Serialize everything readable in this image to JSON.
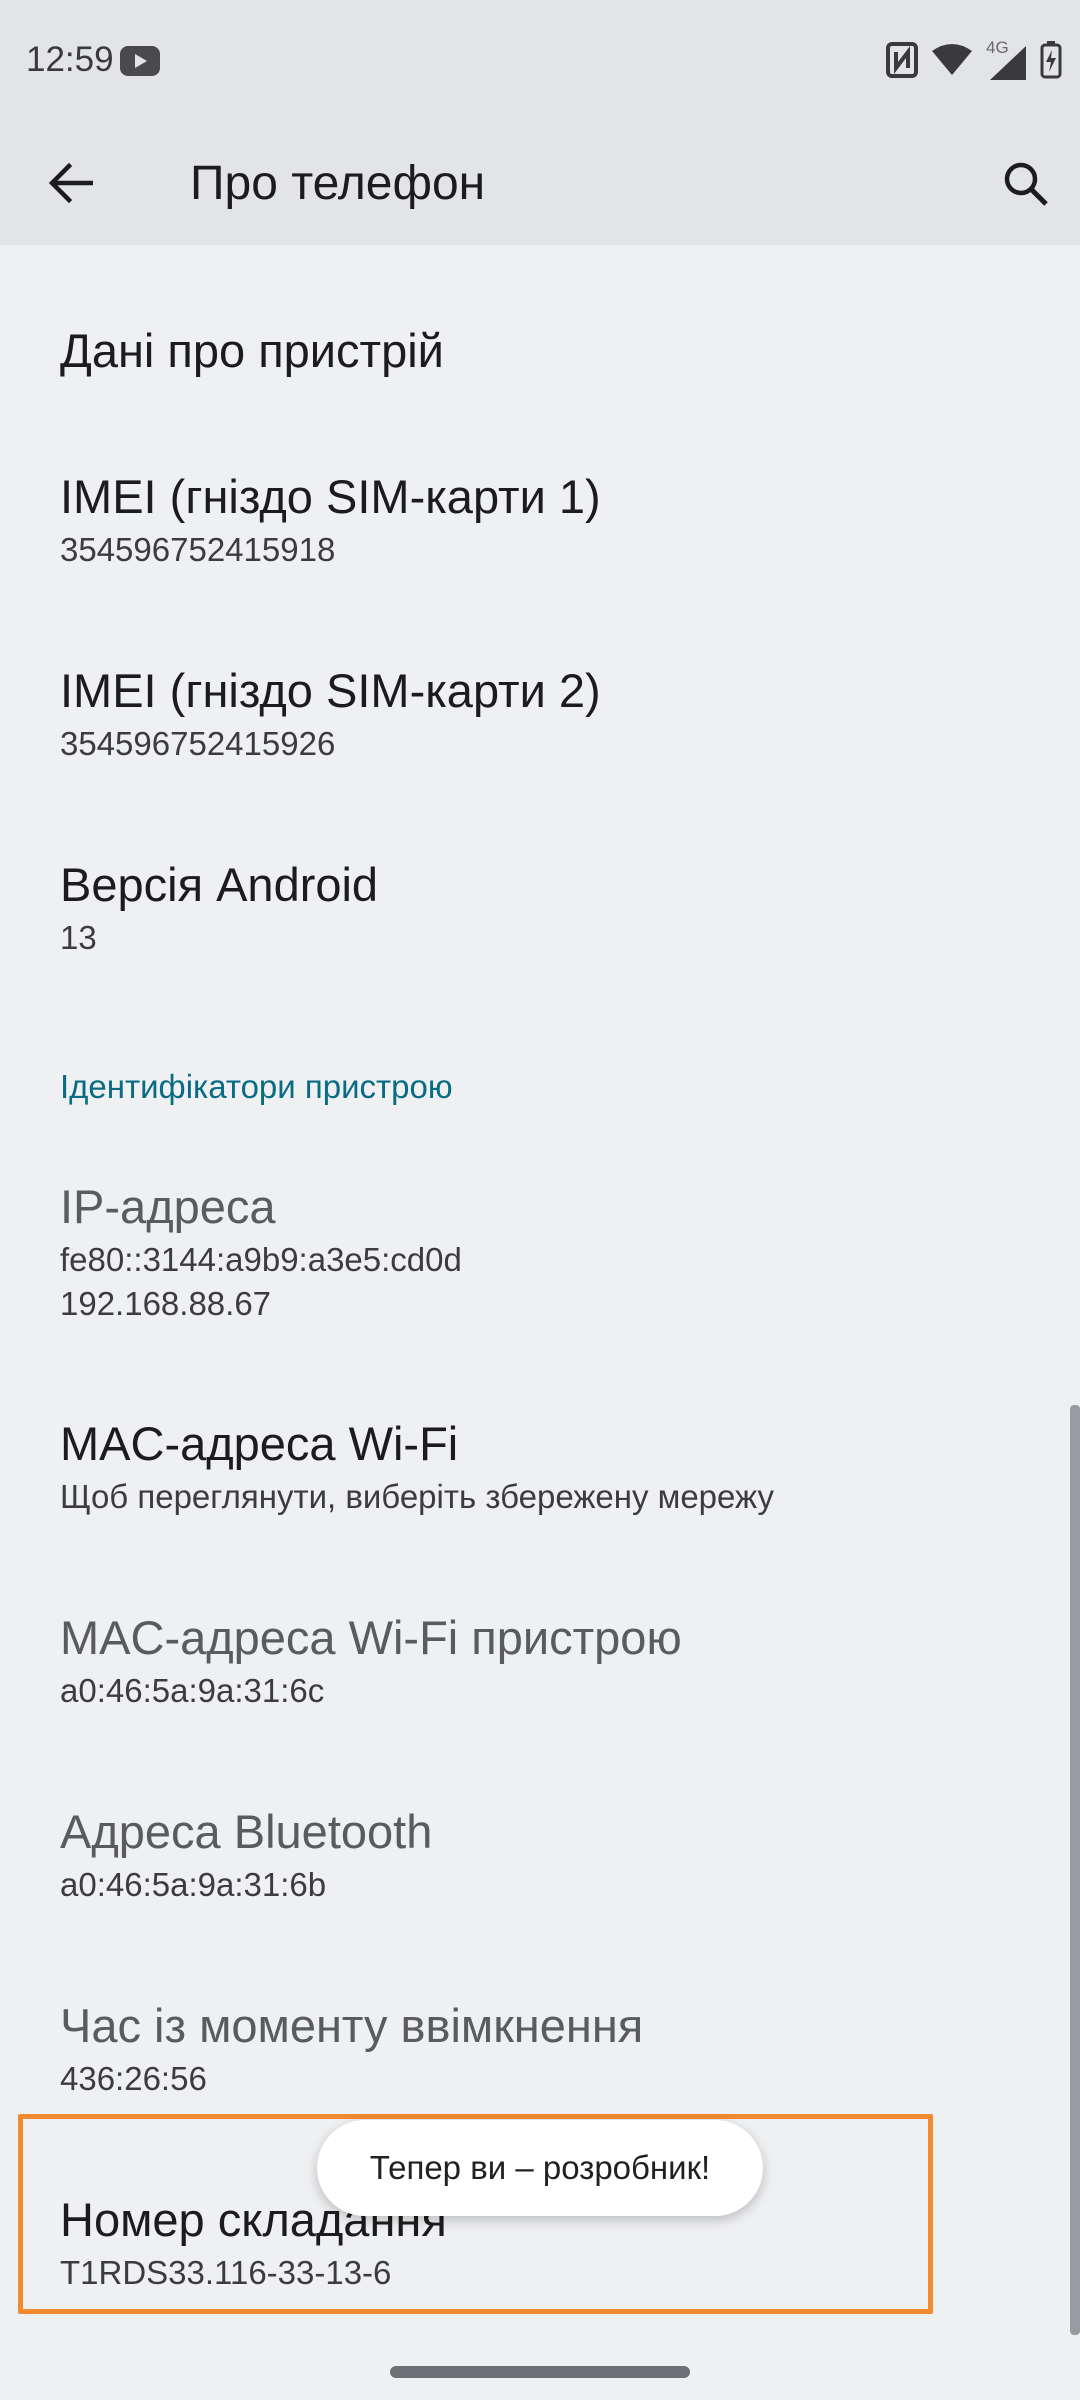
{
  "status_bar": {
    "time": "12:59",
    "network_label": "4G",
    "icons": [
      "youtube-notification-icon",
      "nfc-icon",
      "wifi-icon",
      "cellular-signal-icon",
      "battery-charging-icon"
    ]
  },
  "app_bar": {
    "title": "Про телефон",
    "back_icon": "arrow-back-icon",
    "search_icon": "search-icon"
  },
  "items": [
    {
      "title": "Дані про пристрій",
      "subtitle": ""
    },
    {
      "title": "IMEI (гніздо SIM-карти 1)",
      "subtitle": "354596752415918"
    },
    {
      "title": "IMEI (гніздо SIM-карти 2)",
      "subtitle": "354596752415926"
    },
    {
      "title": "Версія Android",
      "subtitle": "13"
    }
  ],
  "section_header": "Ідентифікатори пристрою",
  "identifiers": [
    {
      "title": "IP-адреса",
      "subtitle_lines": [
        "fe80::3144:a9b9:a3e5:cd0d",
        "192.168.88.67"
      ]
    },
    {
      "title": "MAC-адреса Wi-Fi",
      "subtitle": "Щоб переглянути, виберіть збережену мережу"
    },
    {
      "title": "MAC-адреса Wi-Fi пристрою",
      "subtitle": "a0:46:5a:9a:31:6c"
    },
    {
      "title": "Адреса Bluetooth",
      "subtitle": "a0:46:5a:9a:31:6b"
    },
    {
      "title": "Час із моменту ввімкнення",
      "subtitle": "436:26:56"
    },
    {
      "title": "Номер складання",
      "subtitle": "T1RDS33.116-33-13-6"
    }
  ],
  "toast": "Тепер ви – розробник!",
  "colors": {
    "background": "#eff0f2",
    "app_bar": "#e3e4e6",
    "section_header": "#0a6b84",
    "highlight": "#f28a30"
  }
}
